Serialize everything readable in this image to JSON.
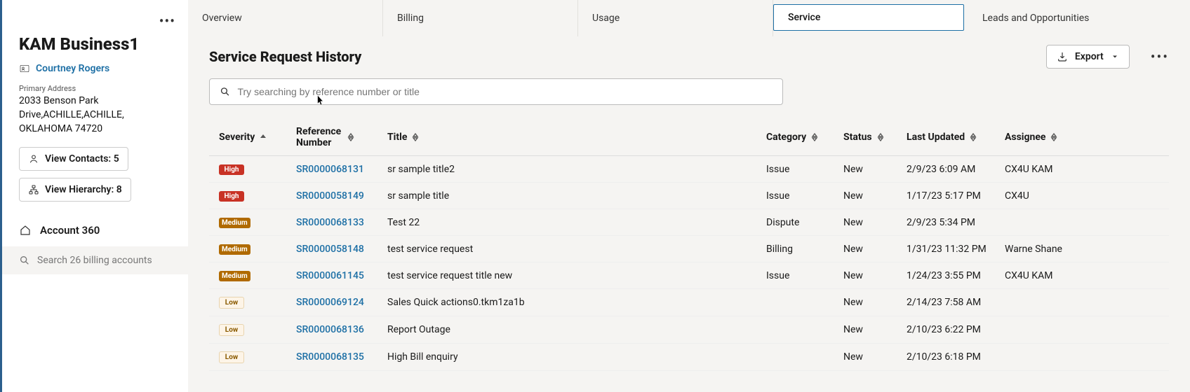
{
  "sidebar": {
    "account_title": "KAM Business1",
    "primary_contact_label": "Courtney Rogers",
    "address_label": "Primary Address",
    "address": "2033 Benson Park Drive,ACHILLE,ACHILLE, OKLAHOMA 74720",
    "view_contacts": "View Contacts: 5",
    "view_hierarchy": "View Hierarchy: 8",
    "nav_account360": "Account 360",
    "search_placeholder": "Search 26 billing accounts"
  },
  "tabs": {
    "overview": "Overview",
    "billing": "Billing",
    "usage": "Usage",
    "service": "Service",
    "leads": "Leads and Opportunities"
  },
  "section": {
    "title": "Service Request History",
    "export_label": "Export",
    "search_placeholder": "Try searching by reference number or title"
  },
  "columns": {
    "severity": "Severity",
    "reference1": "Reference",
    "reference2": "Number",
    "title": "Title",
    "category": "Category",
    "status": "Status",
    "last_updated": "Last Updated",
    "assignee": "Assignee"
  },
  "rows": [
    {
      "severity": "High",
      "ref": "SR0000068131",
      "title": "sr sample title2",
      "category": "Issue",
      "status": "New",
      "updated": "2/9/23 6:09 AM",
      "assignee": "CX4U KAM"
    },
    {
      "severity": "High",
      "ref": "SR0000058149",
      "title": "sr sample title",
      "category": "Issue",
      "status": "New",
      "updated": "1/17/23 5:17 PM",
      "assignee": "CX4U"
    },
    {
      "severity": "Medium",
      "ref": "SR0000068133",
      "title": "Test 22",
      "category": "Dispute",
      "status": "New",
      "updated": "2/9/23 5:34 PM",
      "assignee": ""
    },
    {
      "severity": "Medium",
      "ref": "SR0000058148",
      "title": "test service request",
      "category": "Billing",
      "status": "New",
      "updated": "1/31/23 11:32 PM",
      "assignee": "Warne Shane"
    },
    {
      "severity": "Medium",
      "ref": "SR0000061145",
      "title": "test service request title new",
      "category": "Issue",
      "status": "New",
      "updated": "1/24/23 3:55 PM",
      "assignee": "CX4U KAM"
    },
    {
      "severity": "Low",
      "ref": "SR0000069124",
      "title": "Sales Quick actions0.tkm1za1b",
      "category": "",
      "status": "New",
      "updated": "2/14/23 7:58 AM",
      "assignee": ""
    },
    {
      "severity": "Low",
      "ref": "SR0000068136",
      "title": "Report Outage",
      "category": "",
      "status": "New",
      "updated": "2/10/23 6:22 PM",
      "assignee": ""
    },
    {
      "severity": "Low",
      "ref": "SR0000068135",
      "title": "High Bill enquiry",
      "category": "",
      "status": "New",
      "updated": "2/10/23 6:18 PM",
      "assignee": ""
    }
  ]
}
